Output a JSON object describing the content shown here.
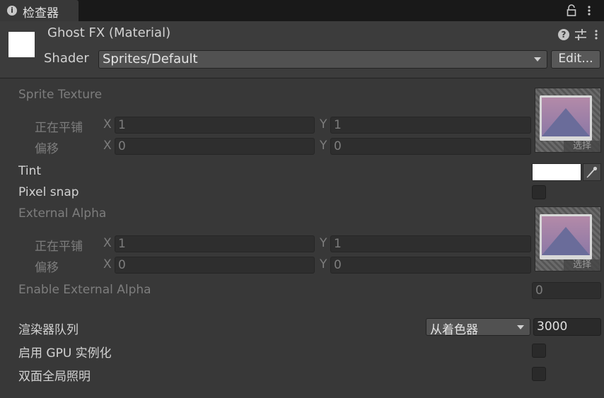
{
  "tab": {
    "title": "检查器",
    "info_icon": "info-icon",
    "lock_icon": "lock-icon",
    "menu_icon": "kebab-menu-icon"
  },
  "header": {
    "title": "Ghost FX (Material)",
    "shader_label": "Shader",
    "shader_value": "Sprites/Default",
    "edit_label": "Edit...",
    "preview_color": "#ffffff"
  },
  "properties": {
    "sprite_texture": {
      "label": "Sprite Texture",
      "tiling_label": "正在平铺",
      "offset_label": "偏移",
      "tiling": {
        "x_axis": "X",
        "x": "1",
        "y_axis": "Y",
        "y": "1"
      },
      "offset": {
        "x_axis": "X",
        "x": "0",
        "y_axis": "Y",
        "y": "0"
      },
      "select_label": "选择"
    },
    "tint": {
      "label": "Tint",
      "color": "#ffffff"
    },
    "pixel_snap": {
      "label": "Pixel snap",
      "checked": false
    },
    "external_alpha": {
      "label": "External Alpha",
      "tiling_label": "正在平铺",
      "offset_label": "偏移",
      "tiling": {
        "x_axis": "X",
        "x": "1",
        "y_axis": "Y",
        "y": "1"
      },
      "offset": {
        "x_axis": "X",
        "x": "0",
        "y_axis": "Y",
        "y": "0"
      },
      "select_label": "选择"
    },
    "enable_external_alpha": {
      "label": "Enable External Alpha",
      "value": "0"
    },
    "render_queue": {
      "label": "渲染器队列",
      "option": "从着色器",
      "value": "3000"
    },
    "gpu_instancing": {
      "label": "启用 GPU 实例化",
      "checked": false
    },
    "double_sided_gi": {
      "label": "双面全局照明",
      "checked": false
    }
  }
}
